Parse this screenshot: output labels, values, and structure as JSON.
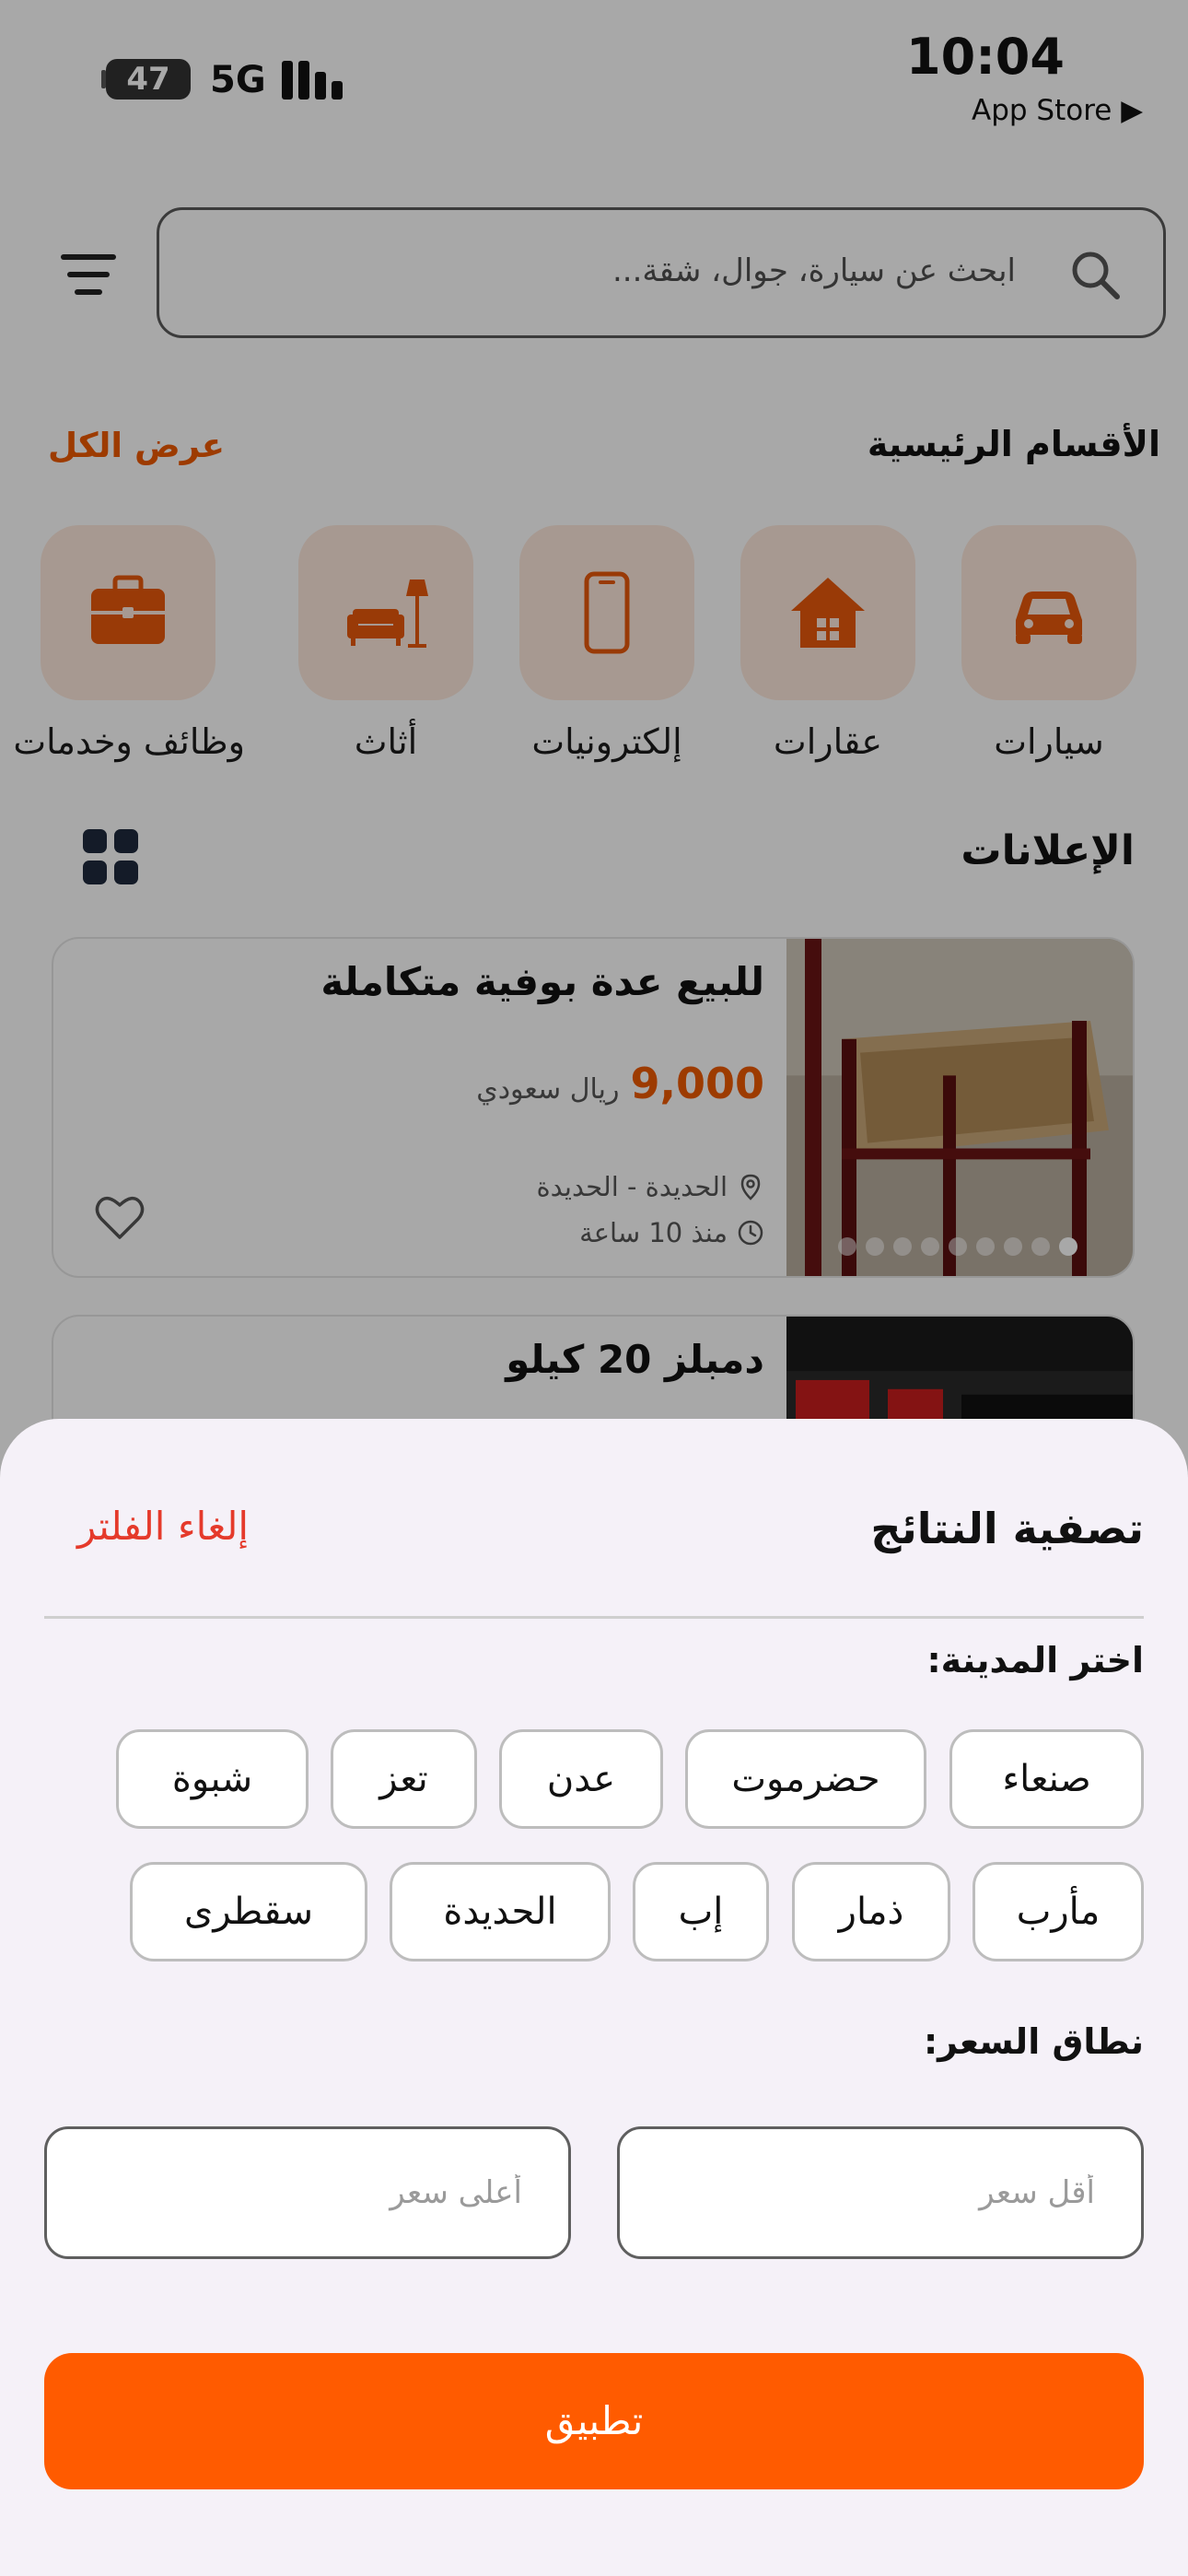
{
  "status_bar": {
    "time": "10:04",
    "back_to": "App Store ▶",
    "battery": "47",
    "network": "5G"
  },
  "search": {
    "placeholder": "ابحث عن سيارة، جوال، شقة..."
  },
  "categories": {
    "title": "الأقسام الرئيسية",
    "view_all": "عرض الكل",
    "items": [
      {
        "label": "سيارات",
        "icon": "car-icon"
      },
      {
        "label": "عقارات",
        "icon": "house-icon"
      },
      {
        "label": "إلكترونيات",
        "icon": "phone-icon"
      },
      {
        "label": "أثاث",
        "icon": "sofa-lamp-icon"
      },
      {
        "label": "وظائف وخدمات",
        "icon": "briefcase-icon"
      }
    ]
  },
  "ads": {
    "title": "الإعلانات",
    "items": [
      {
        "title": "للبيع عدة بوفية متكاملة",
        "price": "9,000",
        "currency": "ريال سعودي",
        "location": "الحديدة - الحديدة",
        "time": "منذ 10 ساعة"
      },
      {
        "title": "دمبلز 20 كيلو"
      }
    ]
  },
  "filter_sheet": {
    "title": "تصفية النتائج",
    "clear": "إلغاء الفلتر",
    "city_label": "اختر المدينة:",
    "cities_row1": [
      "صنعاء",
      "حضرموت",
      "عدن",
      "تعز",
      "شبوة"
    ],
    "cities_row2": [
      "مأرب",
      "ذمار",
      "إب",
      "الحديدة",
      "سقطرى"
    ],
    "price_label": "نطاق السعر:",
    "min_price_placeholder": "أقل سعر",
    "max_price_placeholder": "أعلى سعر",
    "apply": "تطبيق"
  },
  "colors": {
    "accent": "#ff5b00",
    "danger": "#e53a2b",
    "tile_bg": "#fde9dc"
  }
}
